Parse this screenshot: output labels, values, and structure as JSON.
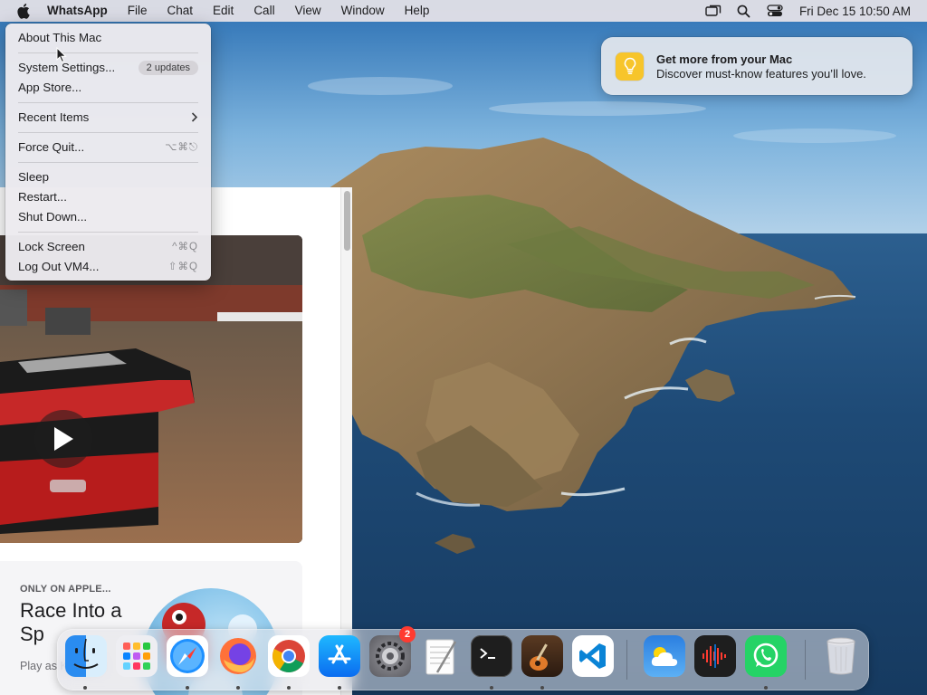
{
  "menubar": {
    "app_name": "WhatsApp",
    "menus": [
      "File",
      "Chat",
      "Edit",
      "Call",
      "View",
      "Window",
      "Help"
    ],
    "clock": "Fri Dec 15  10:50 AM",
    "status_icons": [
      "screen-mirroring-icon",
      "spotlight-search-icon",
      "control-center-icon"
    ]
  },
  "apple_menu": {
    "about": "About This Mac",
    "system_settings": "System Settings...",
    "updates_badge": "2 updates",
    "app_store": "App Store...",
    "recent_items": "Recent Items",
    "force_quit": "Force Quit...",
    "force_quit_shortcut": "⌥⌘⎋",
    "sleep": "Sleep",
    "restart": "Restart...",
    "shut_down": "Shut Down...",
    "lock_screen": "Lock Screen",
    "lock_screen_shortcut": "^⌘Q",
    "log_out": "Log Out VM4...",
    "log_out_shortcut": "⇧⌘Q"
  },
  "notification": {
    "title": "Get more from your Mac",
    "body": "Discover must-know features you’ll love.",
    "icon": "lightbulb-icon",
    "icon_color": "#f7c52b"
  },
  "app_store_window": {
    "card_eyebrow": "ONLY ON APPLE...",
    "card_headline": "Race Into a Sp",
    "card_desc": "Play as Knuckle"
  },
  "dock": {
    "apps": [
      {
        "name": "Finder",
        "icon": "finder-icon",
        "running": true
      },
      {
        "name": "Launchpad",
        "icon": "launchpad-icon",
        "running": false
      },
      {
        "name": "Safari",
        "icon": "safari-icon",
        "running": true
      },
      {
        "name": "Firefox",
        "icon": "firefox-icon",
        "running": true
      },
      {
        "name": "Chrome",
        "icon": "chrome-icon",
        "running": true
      },
      {
        "name": "App Store",
        "icon": "app-store-icon",
        "running": true
      },
      {
        "name": "System Settings",
        "icon": "system-settings-icon",
        "running": false,
        "badge": "2"
      },
      {
        "name": "TextEdit",
        "icon": "textedit-icon",
        "running": false
      },
      {
        "name": "Terminal",
        "icon": "terminal-icon",
        "running": true
      },
      {
        "name": "GarageBand",
        "icon": "garageband-icon",
        "running": true
      },
      {
        "name": "Visual Studio Code",
        "icon": "vscode-icon",
        "running": false
      },
      {
        "name": "Weather",
        "icon": "weather-icon",
        "running": false
      },
      {
        "name": "Voice Memos",
        "icon": "voice-memos-icon",
        "running": false
      },
      {
        "name": "WhatsApp",
        "icon": "whatsapp-icon",
        "running": true
      },
      {
        "name": "Trash",
        "icon": "trash-icon",
        "running": false
      }
    ]
  },
  "colors": {
    "menu_bg": "#ecebee",
    "badge_red": "#ff3b30",
    "accent": "#0a84ff"
  }
}
